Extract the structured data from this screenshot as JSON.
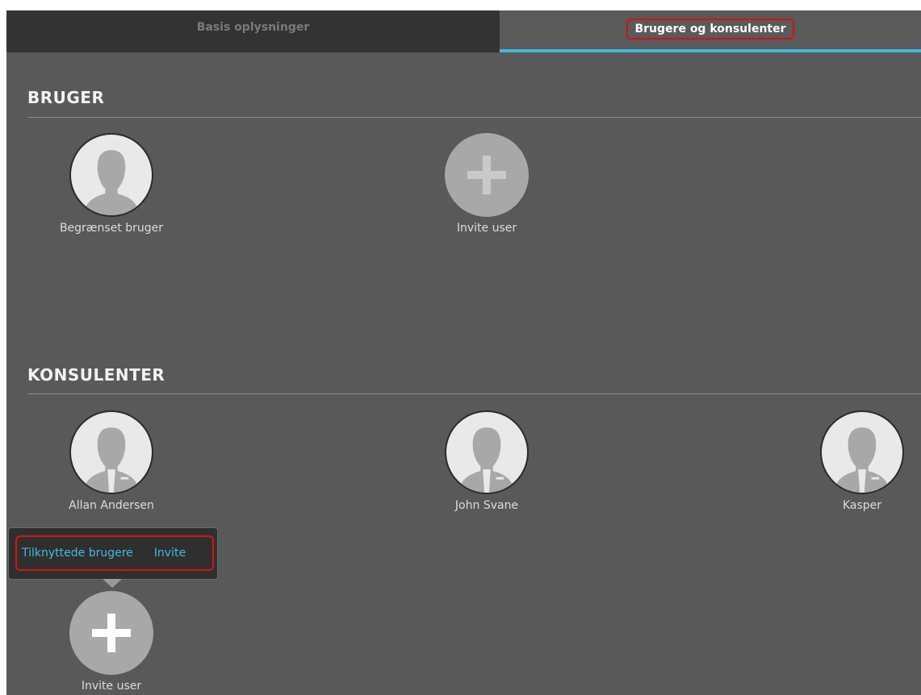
{
  "tabs": [
    {
      "label": "Basis oplysninger",
      "active": false
    },
    {
      "label": "Brugere og konsulenter",
      "active": true
    }
  ],
  "sections": {
    "bruger": {
      "title": "BRUGER",
      "items": [
        {
          "name": "Begrænset bruger",
          "icon": "user-avatar-icon"
        },
        {
          "name": "Invite user",
          "icon": "plus-icon"
        }
      ]
    },
    "konsulenter": {
      "title": "KONSULENTER",
      "items": [
        {
          "name": "Allan Andersen",
          "icon": "consultant-avatar-icon"
        },
        {
          "name": "John Svane",
          "icon": "consultant-avatar-icon"
        },
        {
          "name": "Kasper",
          "icon": "consultant-avatar-icon"
        },
        {
          "name": "Invite user",
          "icon": "plus-icon"
        }
      ]
    }
  },
  "popup": {
    "link1": "Tilknyttede brugere",
    "link2": "Invite"
  },
  "colors": {
    "background": "#595959",
    "active_tab_underline": "#45b4de",
    "highlight": "#d21414",
    "link": "#45b8e0"
  }
}
